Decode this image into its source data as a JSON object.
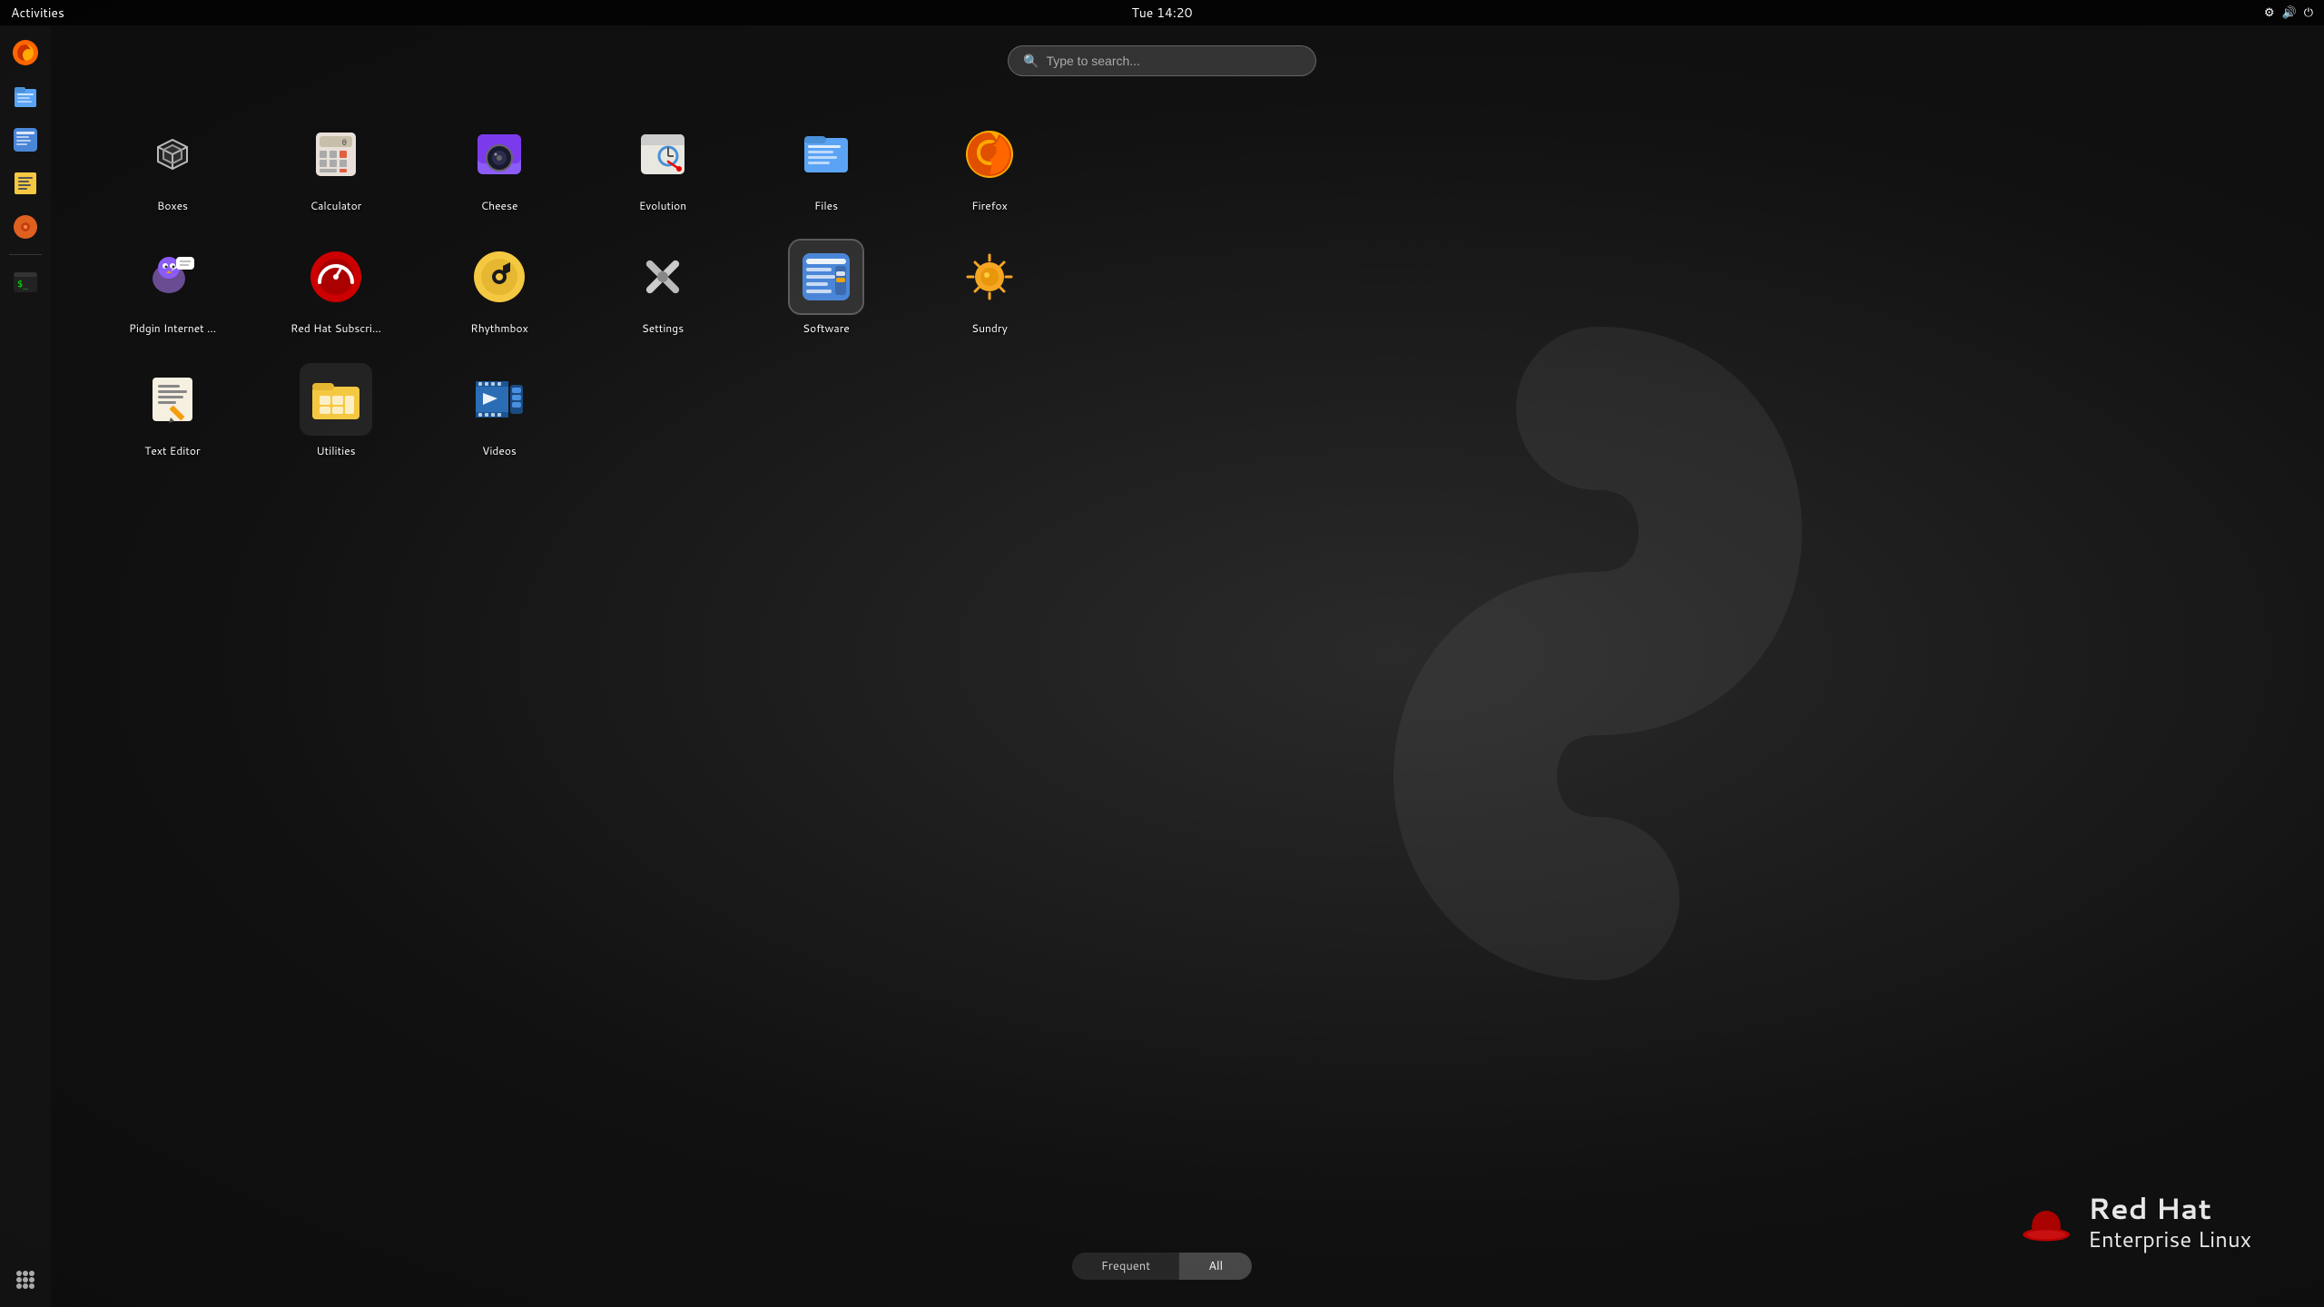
{
  "topbar": {
    "activities_label": "Activities",
    "clock": "Tue 14:20"
  },
  "search": {
    "placeholder": "Type to search..."
  },
  "apps_row1": [
    {
      "id": "boxes",
      "label": "Boxes",
      "icon": "boxes"
    },
    {
      "id": "calculator",
      "label": "Calculator",
      "icon": "calculator"
    },
    {
      "id": "cheese",
      "label": "Cheese",
      "icon": "cheese"
    },
    {
      "id": "evolution",
      "label": "Evolution",
      "icon": "evolution"
    },
    {
      "id": "files",
      "label": "Files",
      "icon": "files"
    },
    {
      "id": "firefox",
      "label": "Firefox",
      "icon": "firefox"
    }
  ],
  "apps_row2": [
    {
      "id": "pidgin",
      "label": "Pidgin Internet ...",
      "icon": "pidgin"
    },
    {
      "id": "redhat-subscri",
      "label": "Red Hat Subscri...",
      "icon": "redhat"
    },
    {
      "id": "rhythmbox",
      "label": "Rhythmbox",
      "icon": "rhythmbox"
    },
    {
      "id": "settings",
      "label": "Settings",
      "icon": "settings"
    },
    {
      "id": "software",
      "label": "Software",
      "icon": "software",
      "selected": true
    },
    {
      "id": "sundry",
      "label": "Sundry",
      "icon": "sundry"
    }
  ],
  "apps_row3": [
    {
      "id": "text-editor",
      "label": "Text Editor",
      "icon": "text-editor"
    },
    {
      "id": "utilities",
      "label": "Utilities",
      "icon": "utilities"
    },
    {
      "id": "videos",
      "label": "Videos",
      "icon": "videos"
    }
  ],
  "bottom_tabs": [
    {
      "id": "frequent",
      "label": "Frequent",
      "active": false
    },
    {
      "id": "all",
      "label": "All",
      "active": true
    }
  ],
  "dock": {
    "items": [
      {
        "id": "firefox-dock",
        "icon": "firefox",
        "label": "Firefox"
      },
      {
        "id": "files-dock",
        "icon": "files",
        "label": "Files"
      },
      {
        "id": "software-dock",
        "icon": "software",
        "label": "Software"
      },
      {
        "id": "notes-dock",
        "icon": "notes",
        "label": "Notes"
      },
      {
        "id": "books-dock",
        "icon": "books",
        "label": "Books"
      },
      {
        "id": "terminal-dock",
        "icon": "terminal",
        "label": "Terminal"
      },
      {
        "id": "appgrid-dock",
        "icon": "appgrid",
        "label": "App Grid"
      }
    ]
  },
  "rhel_logo": {
    "line1": "Red Hat",
    "line2": "Enterprise Linux"
  },
  "colors": {
    "accent": "#e00",
    "bg": "#111111",
    "topbar": "#000000"
  }
}
